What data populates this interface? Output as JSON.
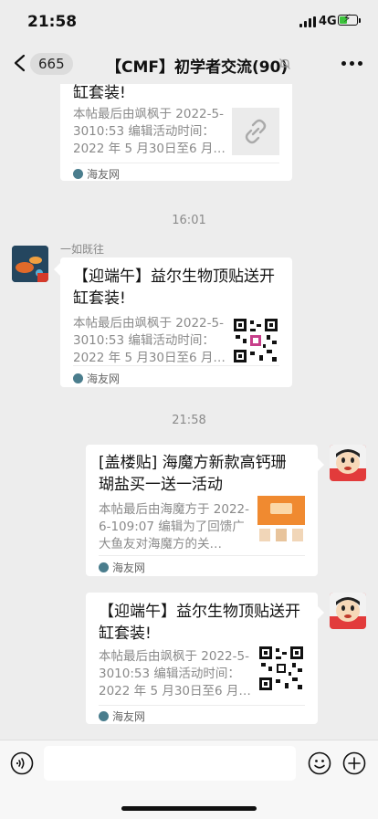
{
  "status": {
    "time": "21:58",
    "network": "4G"
  },
  "header": {
    "unread_count": "665",
    "title": "【CMF】初学者交流(90)"
  },
  "messages": [
    {
      "title": "缸套装!",
      "desc": "本帖最后由飒枫于 2022-5-3010:53 编辑活动时间：2022 年 5 月30日至6 月…",
      "source": "海友网",
      "thumb": "link-icon"
    },
    {
      "timestamp": "16:01"
    },
    {
      "sender": "一如既往",
      "title": "【迎端午】益尔生物顶贴送开缸套装!",
      "desc": "本帖最后由飒枫于 2022-5-3010:53 编辑活动时间：2022 年 5 月30日至6 月…",
      "source": "海友网",
      "thumb": "qr-code"
    },
    {
      "timestamp": "21:58"
    },
    {
      "title": "[盖楼贴] 海魔方新款高钙珊 瑚盐买一送一活动",
      "desc": "本帖最后由海魔方于 2022-6-109:07 编辑为了回馈广大鱼友对海魔方的关…",
      "source": "海友网",
      "thumb": "product-image"
    },
    {
      "title": "【迎端午】益尔生物顶贴送开缸套装!",
      "desc": "本帖最后由飒枫于 2022-5-3010:53 编辑活动时间：2022 年 5 月30日至6 月…",
      "source": "海友网",
      "thumb": "qr-code"
    }
  ],
  "colors": {
    "bg": "#ededed",
    "card": "#ffffff",
    "muted": "#8a8a8a",
    "battery": "#3cc33c"
  }
}
